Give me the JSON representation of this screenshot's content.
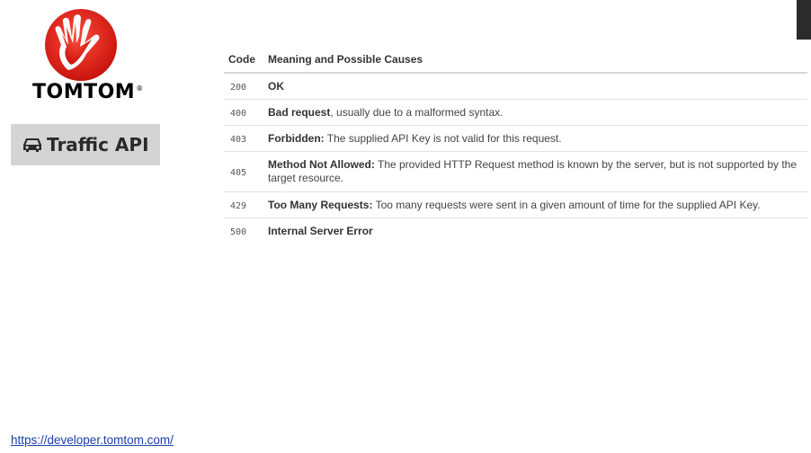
{
  "logo": {
    "wordmark": "TOMTOM",
    "registered": "®"
  },
  "badge": {
    "icon": "car-icon",
    "label": "Traffic API"
  },
  "table": {
    "headers": {
      "code": "Code",
      "meaning": "Meaning and Possible Causes"
    },
    "rows": [
      {
        "code": "200",
        "term": "OK",
        "desc": ""
      },
      {
        "code": "400",
        "term": "Bad request",
        "desc": ", usually due to a malformed syntax."
      },
      {
        "code": "403",
        "term": "Forbidden:",
        "desc": " The supplied API Key is not valid for this request."
      },
      {
        "code": "405",
        "term": "Method Not Allowed:",
        "desc": " The provided HTTP Request method is known by the server, but is not supported by the target resource."
      },
      {
        "code": "429",
        "term": "Too Many Requests:",
        "desc": " Too many requests were sent in a given amount of time for the supplied API Key."
      },
      {
        "code": "500",
        "term": "Internal Server Error",
        "desc": ""
      }
    ]
  },
  "footer": {
    "link": "https://developer.tomtom.com/"
  },
  "colors": {
    "brand_red": "#e2231a",
    "link_blue": "#1a3fa8",
    "badge_bg": "#d4d4d4"
  }
}
